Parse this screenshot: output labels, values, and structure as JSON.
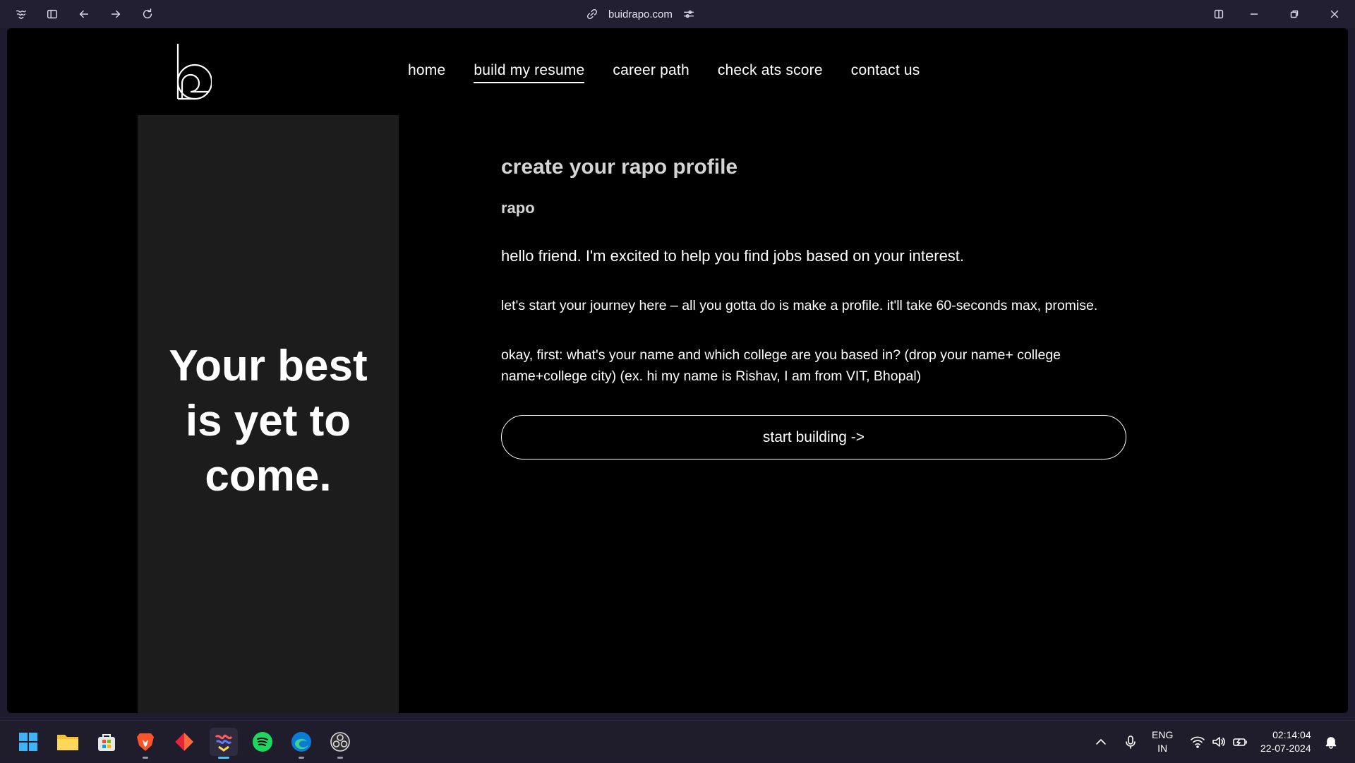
{
  "browser": {
    "url": "buidrapo.com"
  },
  "site": {
    "nav": [
      {
        "label": "home",
        "active": false
      },
      {
        "label": "build my resume",
        "active": true
      },
      {
        "label": "career path",
        "active": false
      },
      {
        "label": "check ats score",
        "active": false
      },
      {
        "label": "contact us",
        "active": false
      }
    ],
    "tagline": "Your best is yet to come.",
    "profile_title": "create your rapo profile",
    "bot_name": "rapo",
    "messages": [
      "hello friend. I'm excited to help you find jobs based on your interest.",
      "let's start your journey here – all you gotta do is make a profile. it'll take 60-seconds max, promise.",
      "okay, first: what's your name and which college are you based in? (drop your name+ college name+college city) (ex. hi my name is Rishav, I am from VIT, Bhopal)"
    ],
    "start_button": "start building ->"
  },
  "taskbar": {
    "apps": [
      "start-icon",
      "file-explorer-icon",
      "microsoft-store-icon",
      "brave-icon",
      "git-app-icon",
      "arc-browser-icon",
      "spotify-icon",
      "edge-icon",
      "obs-icon"
    ],
    "lang_line1": "ENG",
    "lang_line2": "IN",
    "time": "02:14:04",
    "date": "22-07-2024"
  },
  "colors": {
    "page_bg": "#000000",
    "side_panel": "#1c1c1c",
    "chrome_bg": "#231f33",
    "taskbar_bg": "#1f1c2c",
    "taskbar_active": "#4cc2ff"
  }
}
